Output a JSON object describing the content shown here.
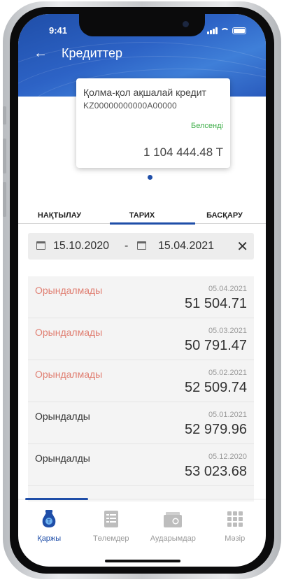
{
  "status_bar": {
    "time": "9:41"
  },
  "header": {
    "back_icon": "arrow-left-icon",
    "title": "Кредиттер"
  },
  "loan_card": {
    "name": "Қолма-қол ақшалай кредит",
    "account": "KZ00000000000A00000",
    "status": "Белсенді",
    "amount": "1 104 444.48 T",
    "status_color": "#3fae4a"
  },
  "tabs": [
    {
      "label": "НАҚТЫЛАУ",
      "active": false
    },
    {
      "label": "ТАРИХ",
      "active": true
    },
    {
      "label": "БАСҚАРУ",
      "active": false
    }
  ],
  "date_filter": {
    "from": "15.10.2020",
    "separator": "-",
    "to": "15.04.2021",
    "clear_icon": "close-icon",
    "calendar_icon": "calendar-icon"
  },
  "payments": [
    {
      "status": "Орындалмады",
      "date": "05.04.2021",
      "amount": "51 504.71",
      "failed": true
    },
    {
      "status": "Орындалмады",
      "date": "05.03.2021",
      "amount": "50 791.47",
      "failed": true
    },
    {
      "status": "Орындалмады",
      "date": "05.02.2021",
      "amount": "52 509.74",
      "failed": true
    },
    {
      "status": "Орындалды",
      "date": "05.01.2021",
      "amount": "52 979.96",
      "failed": false
    },
    {
      "status": "Орындалды",
      "date": "05.12.2020",
      "amount": "53 023.68",
      "failed": false
    }
  ],
  "bottom_nav": [
    {
      "label": "Қаржы",
      "icon": "money-bag-icon",
      "active": true
    },
    {
      "label": "Төлемдер",
      "icon": "payments-list-icon",
      "active": false
    },
    {
      "label": "Аударымдар",
      "icon": "wallet-transfer-icon",
      "active": false
    },
    {
      "label": "Мәзір",
      "icon": "grid-menu-icon",
      "active": false
    }
  ],
  "colors": {
    "brand": "#1f4ea8",
    "failed": "#e07f72",
    "success": "#3fae4a"
  }
}
